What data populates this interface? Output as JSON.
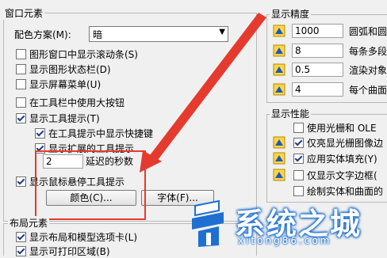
{
  "window_group": {
    "title": "窗口元素",
    "color_scheme_label": "配色方案(M):",
    "color_scheme_value": "暗",
    "options": [
      {
        "label": "图形窗口中显示滚动条(S)",
        "checked": false
      },
      {
        "label": "显示图形状态栏(D)",
        "checked": false
      },
      {
        "label": "显示屏幕菜单(U)",
        "checked": false
      },
      {
        "label": "在工具栏中使用大按钮",
        "checked": false
      },
      {
        "label": "显示工具提示(T)",
        "checked": true
      }
    ],
    "tooltip_sub": [
      {
        "label": "在工具提示中显示快捷键",
        "checked": true
      },
      {
        "label": "显示扩展的工具提示",
        "checked": true
      }
    ],
    "delay_value": "2",
    "delay_label": "延迟的秒数",
    "hover_tooltip": {
      "label": "显示鼠标悬停工具提示",
      "checked": true
    },
    "color_button": "颜色(C)...",
    "font_button": "字体(F)..."
  },
  "layout_group": {
    "title": "布局元素",
    "options": [
      {
        "label": "显示布局和模型选项卡(L)",
        "checked": true
      },
      {
        "label": "显示可打印区域(B)",
        "checked": true
      }
    ]
  },
  "precision_group": {
    "title": "显示精度",
    "rows": [
      {
        "value": "1000",
        "label": "圆弧和圆"
      },
      {
        "value": "8",
        "label": "每条多段"
      },
      {
        "value": "0.5",
        "label": "渲染对象"
      },
      {
        "value": "4",
        "label": "每个曲面"
      }
    ]
  },
  "performance_group": {
    "title": "显示性能",
    "options": [
      {
        "label": "使用光栅和 OLE",
        "checked": false
      },
      {
        "label": "仅亮显光栅图像边",
        "checked": true
      },
      {
        "label": "应用实体填充(Y)",
        "checked": true
      },
      {
        "label": "仅显示文字边框(",
        "checked": false
      },
      {
        "label": "绘制实体和曲面的",
        "checked": false
      }
    ]
  },
  "watermark": {
    "title": "系统之城",
    "url": "xitong86.com"
  },
  "colors": {
    "annotation_red": "#e53a2e",
    "watermark_blue": "#1e6fd0"
  }
}
